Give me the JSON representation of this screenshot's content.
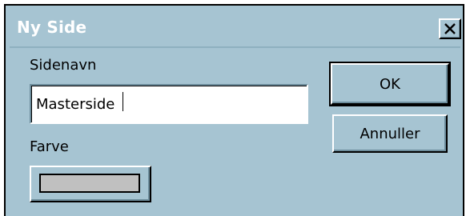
{
  "window": {
    "title": "Ny Side",
    "close_glyph": "✕",
    "close_icon": "close-icon"
  },
  "fields": {
    "name_label": "Sidenavn",
    "name_value": "Masterside",
    "color_label": "Farve",
    "color_value": "#c0c0c0"
  },
  "buttons": {
    "ok_label": "OK",
    "cancel_label": "Annuller"
  },
  "colors": {
    "dialog_bg": "#a6c4d2",
    "title_text": "#ffffff"
  }
}
